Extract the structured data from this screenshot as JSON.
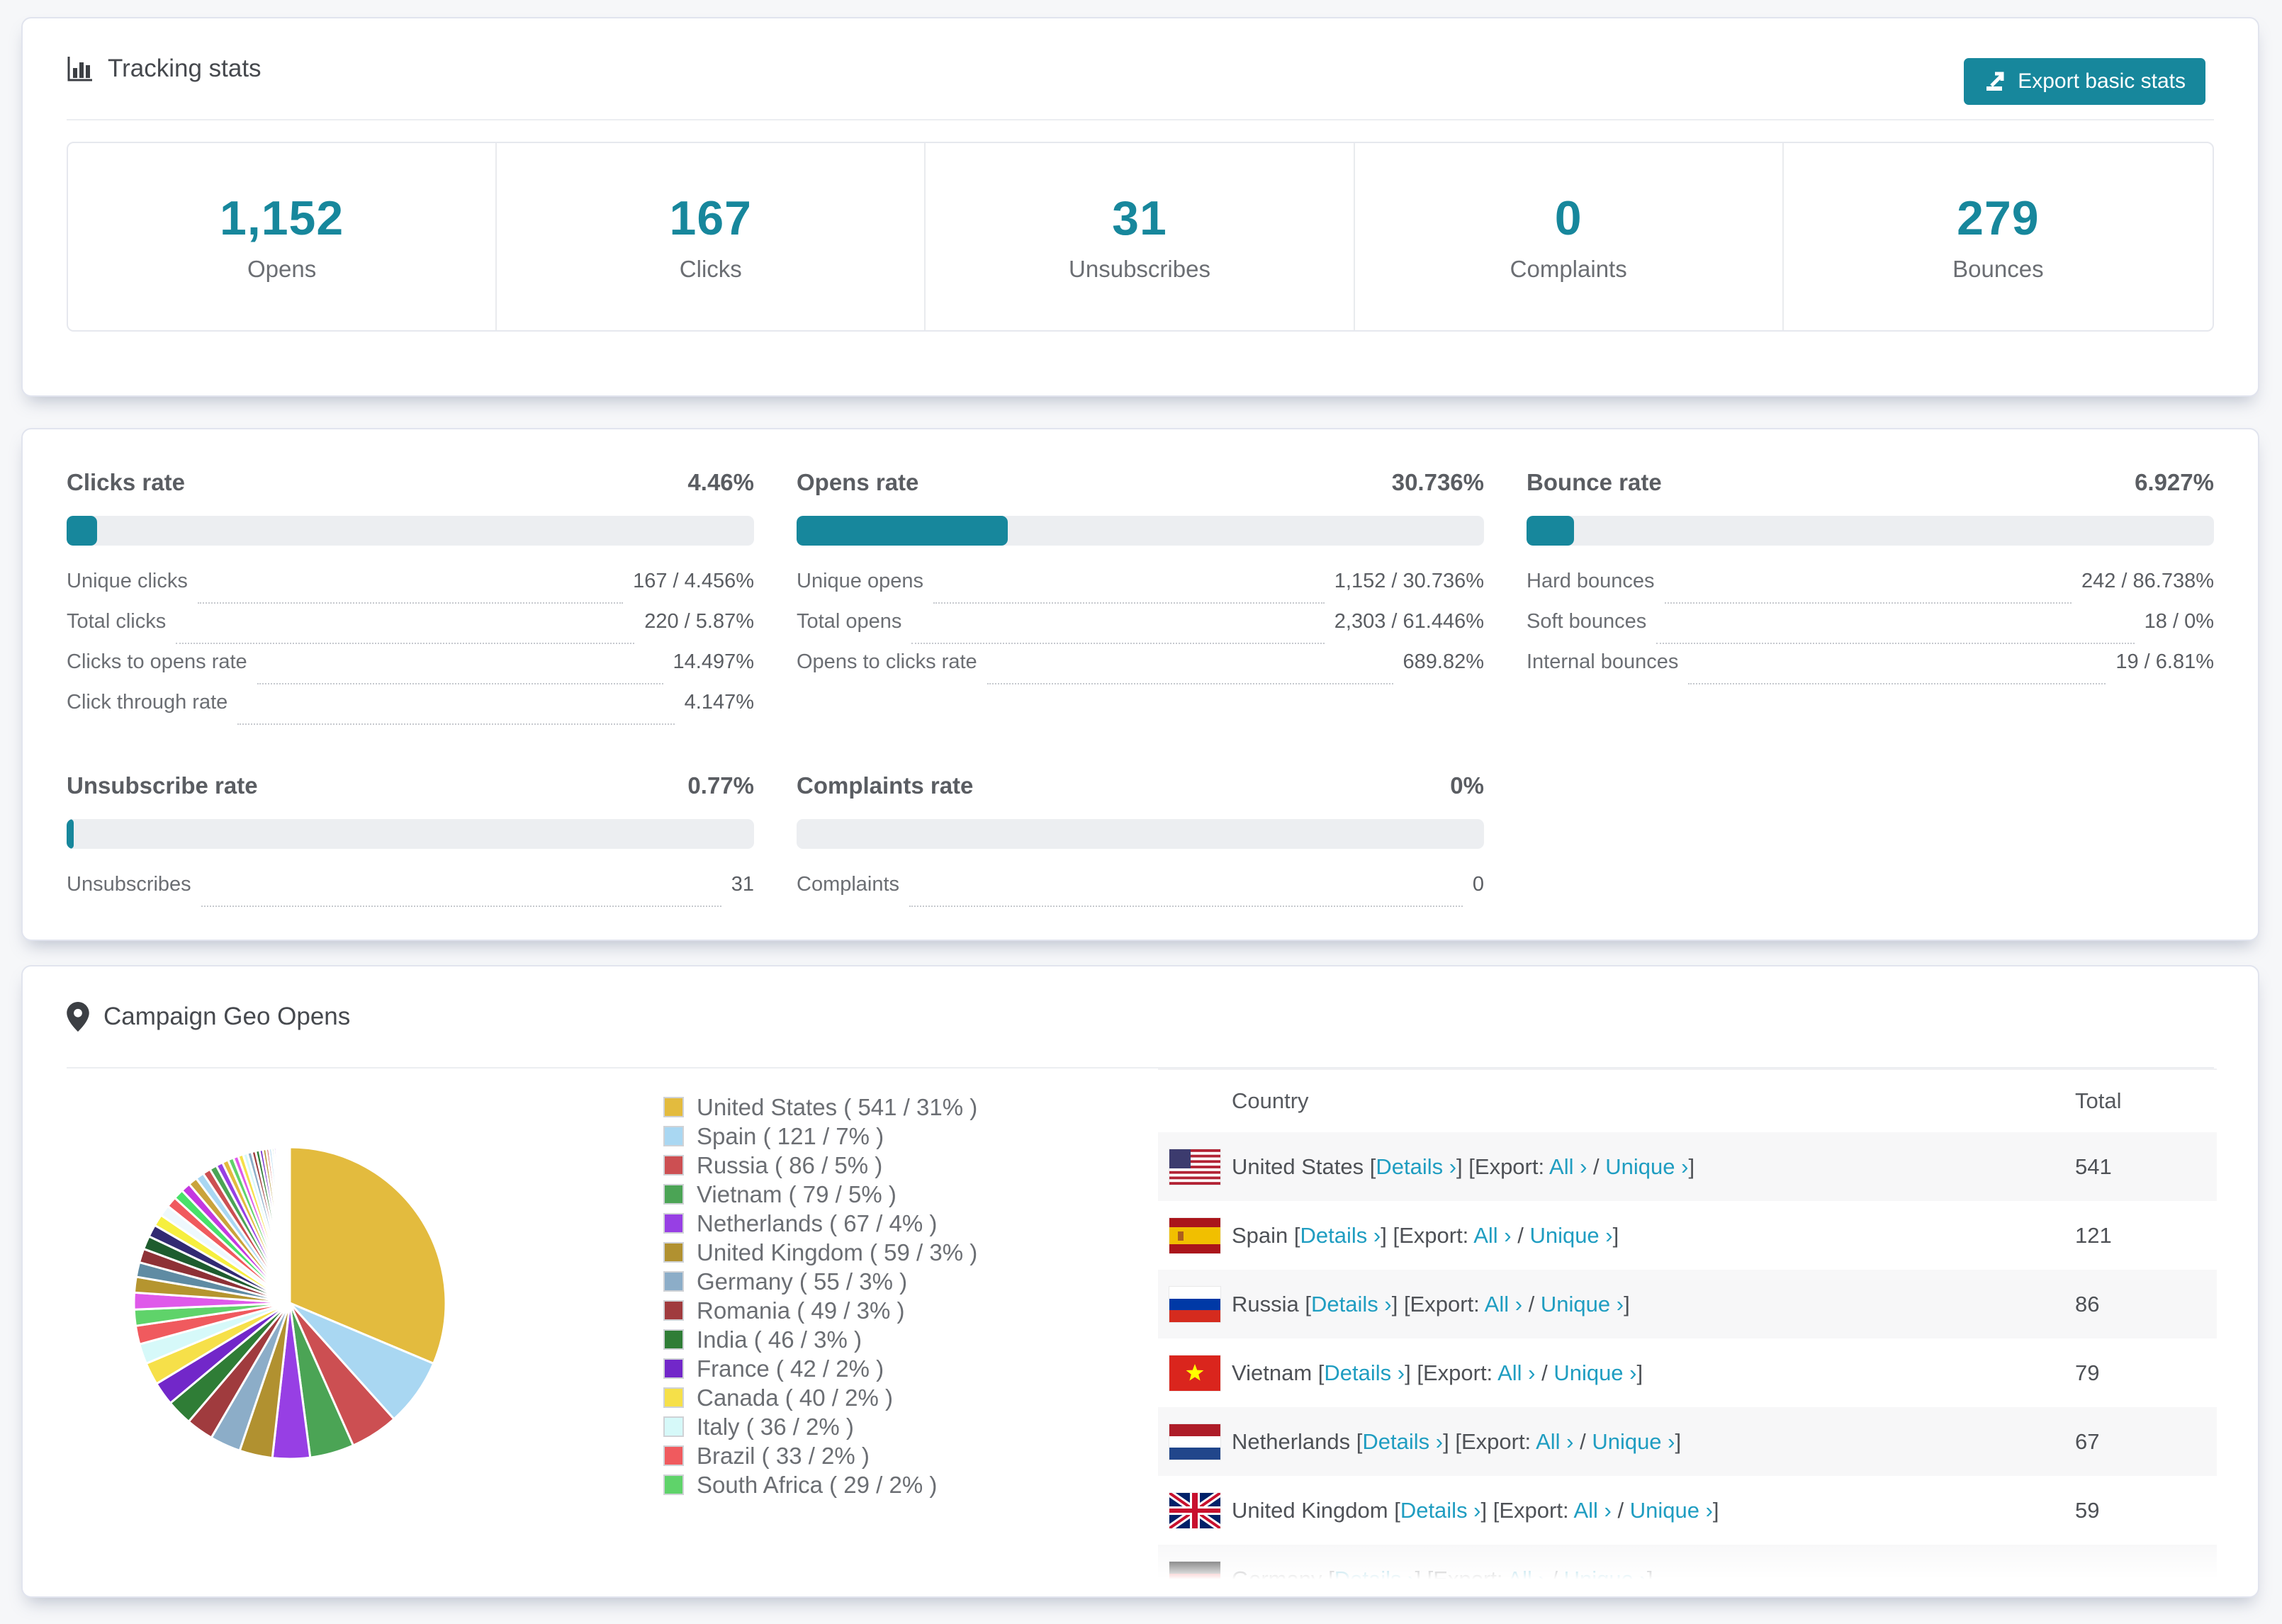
{
  "accent": {
    "teal": "#17879c",
    "link_teal": "#1f9dc1"
  },
  "tracking_header": {
    "title": "Tracking stats",
    "icon": "bar-chart-icon",
    "export_label": "Export basic stats",
    "export_icon": "export-icon"
  },
  "summary_stats": [
    {
      "value": "1,152",
      "label": "Opens"
    },
    {
      "value": "167",
      "label": "Clicks"
    },
    {
      "value": "31",
      "label": "Unsubscribes"
    },
    {
      "value": "0",
      "label": "Complaints"
    },
    {
      "value": "279",
      "label": "Bounces"
    }
  ],
  "rates": [
    {
      "title": "Clicks rate",
      "value": "4.46%",
      "bar_pct": 4.46,
      "row": 1,
      "rows": [
        {
          "label": "Unique clicks",
          "value": "167 / 4.456%"
        },
        {
          "label": "Total clicks",
          "value": "220 / 5.87%"
        },
        {
          "label": "Clicks to opens rate",
          "value": "14.497%"
        },
        {
          "label": "Click through rate",
          "value": "4.147%"
        }
      ]
    },
    {
      "title": "Opens rate",
      "value": "30.736%",
      "bar_pct": 30.736,
      "row": 1,
      "rows": [
        {
          "label": "Unique opens",
          "value": "1,152 / 30.736%"
        },
        {
          "label": "Total opens",
          "value": "2,303 / 61.446%"
        },
        {
          "label": "Opens to clicks rate",
          "value": "689.82%"
        }
      ]
    },
    {
      "title": "Bounce rate",
      "value": "6.927%",
      "bar_pct": 6.927,
      "row": 1,
      "rows": [
        {
          "label": "Hard bounces",
          "value": "242 / 86.738%"
        },
        {
          "label": "Soft bounces",
          "value": "18 / 0%"
        },
        {
          "label": "Internal bounces",
          "value": "19 / 6.81%"
        }
      ]
    },
    {
      "title": "Unsubscribe rate",
      "value": "0.77%",
      "bar_pct": 0.77,
      "row": 2,
      "rows": [
        {
          "label": "Unsubscribes",
          "value": "31"
        }
      ]
    },
    {
      "title": "Complaints rate",
      "value": "0%",
      "bar_pct": 0,
      "row": 2,
      "rows": [
        {
          "label": "Complaints",
          "value": "0"
        }
      ]
    }
  ],
  "geo": {
    "title": "Campaign Geo Opens",
    "icon": "map-pin-icon",
    "columns": {
      "country": "Country",
      "total": "Total"
    },
    "link_text": {
      "details": "Details ›",
      "export_prefix": "[Export:",
      "all": "All ›",
      "sep": "/",
      "unique": "Unique ›",
      "close": "]"
    },
    "table_rows": [
      {
        "country": "United States",
        "flag": "us",
        "total": "541"
      },
      {
        "country": "Spain",
        "flag": "es",
        "total": "121"
      },
      {
        "country": "Russia",
        "flag": "ru",
        "total": "86"
      },
      {
        "country": "Vietnam",
        "flag": "vn",
        "total": "79"
      },
      {
        "country": "Netherlands",
        "flag": "nl",
        "total": "67"
      },
      {
        "country": "United Kingdom",
        "flag": "gb",
        "total": "59"
      },
      {
        "country": "Germany",
        "flag": "de",
        "total": ""
      }
    ]
  },
  "chart_data": {
    "type": "pie",
    "title": "Campaign Geo Opens",
    "legend_position": "right",
    "start_angle_deg": -90,
    "direction": "clockwise",
    "slices": [
      {
        "label": "United States",
        "count": 541,
        "pct": 31,
        "color": "#e3bb3e"
      },
      {
        "label": "Spain",
        "count": 121,
        "pct": 7,
        "color": "#a9d7f2"
      },
      {
        "label": "Russia",
        "count": 86,
        "pct": 5,
        "color": "#cc4f52"
      },
      {
        "label": "Vietnam",
        "count": 79,
        "pct": 5,
        "color": "#4ba455"
      },
      {
        "label": "Netherlands",
        "count": 67,
        "pct": 4,
        "color": "#973fe4"
      },
      {
        "label": "United Kingdom",
        "count": 59,
        "pct": 3,
        "color": "#b19130"
      },
      {
        "label": "Germany",
        "count": 55,
        "pct": 3,
        "color": "#8cadc8"
      },
      {
        "label": "Romania",
        "count": 49,
        "pct": 3,
        "color": "#a03b3e"
      },
      {
        "label": "India",
        "count": 46,
        "pct": 3,
        "color": "#2f7d36"
      },
      {
        "label": "France",
        "count": 42,
        "pct": 2,
        "color": "#7227c9"
      },
      {
        "label": "Canada",
        "count": 40,
        "pct": 2,
        "color": "#f6e049"
      },
      {
        "label": "Italy",
        "count": 36,
        "pct": 2,
        "color": "#d6f9f9"
      },
      {
        "label": "Brazil",
        "count": 33,
        "pct": 2,
        "color": "#f05a5e"
      },
      {
        "label": "South Africa",
        "count": 29,
        "pct": 2,
        "color": "#5fd36a"
      }
    ],
    "other_unlabeled_segments": [
      {
        "value": 30,
        "color": "#df59ea"
      },
      {
        "value": 28,
        "color": "#b5952f"
      },
      {
        "value": 26,
        "color": "#5f8ba3"
      },
      {
        "value": 25,
        "color": "#8e3136"
      },
      {
        "value": 24,
        "color": "#1e5c2e"
      },
      {
        "value": 22,
        "color": "#322a72"
      },
      {
        "value": 21,
        "color": "#f6ef3f"
      },
      {
        "value": 20,
        "color": "#eef8fd"
      },
      {
        "value": 19,
        "color": "#f05a5e"
      },
      {
        "value": 18,
        "color": "#49e169"
      },
      {
        "value": 17,
        "color": "#c438e0"
      },
      {
        "value": 16,
        "color": "#caa33b"
      },
      {
        "value": 15,
        "color": "#a9d7f2"
      },
      {
        "value": 14,
        "color": "#cc4f52"
      },
      {
        "value": 13,
        "color": "#4ba455"
      },
      {
        "value": 12,
        "color": "#973fe4"
      },
      {
        "value": 11,
        "color": "#e3bb3e"
      },
      {
        "value": 10,
        "color": "#5fd36a"
      },
      {
        "value": 9,
        "color": "#df59ea"
      },
      {
        "value": 9,
        "color": "#f6e049"
      },
      {
        "value": 8,
        "color": "#d6f9f9"
      },
      {
        "value": 8,
        "color": "#8cadc8"
      },
      {
        "value": 7,
        "color": "#a03b3e"
      },
      {
        "value": 7,
        "color": "#2f7d36"
      },
      {
        "value": 6,
        "color": "#7227c9"
      },
      {
        "value": 6,
        "color": "#b5952f"
      },
      {
        "value": 5,
        "color": "#cc4f52"
      },
      {
        "value": 5,
        "color": "#a9d7f2"
      },
      {
        "value": 4,
        "color": "#4ba455"
      },
      {
        "value": 4,
        "color": "#973fe4"
      },
      {
        "value": 3,
        "color": "#e3bb3e"
      },
      {
        "value": 3,
        "color": "#df59ea"
      },
      {
        "value": 3,
        "color": "#f6ef3f"
      },
      {
        "value": 2,
        "color": "#49e169"
      },
      {
        "value": 2,
        "color": "#c438e0"
      },
      {
        "value": 2,
        "color": "#8e3136"
      },
      {
        "value": 2,
        "color": "#322a72"
      },
      {
        "value": 1,
        "color": "#5f8ba3"
      },
      {
        "value": 1,
        "color": "#caa33b"
      },
      {
        "value": 1,
        "color": "#f05a5e"
      },
      {
        "value": 1,
        "color": "#7227c9"
      },
      {
        "value": 1,
        "color": "#1e5c2e"
      },
      {
        "value": 1,
        "color": "#df59ea"
      },
      {
        "value": 1,
        "color": "#b5952f"
      }
    ]
  }
}
